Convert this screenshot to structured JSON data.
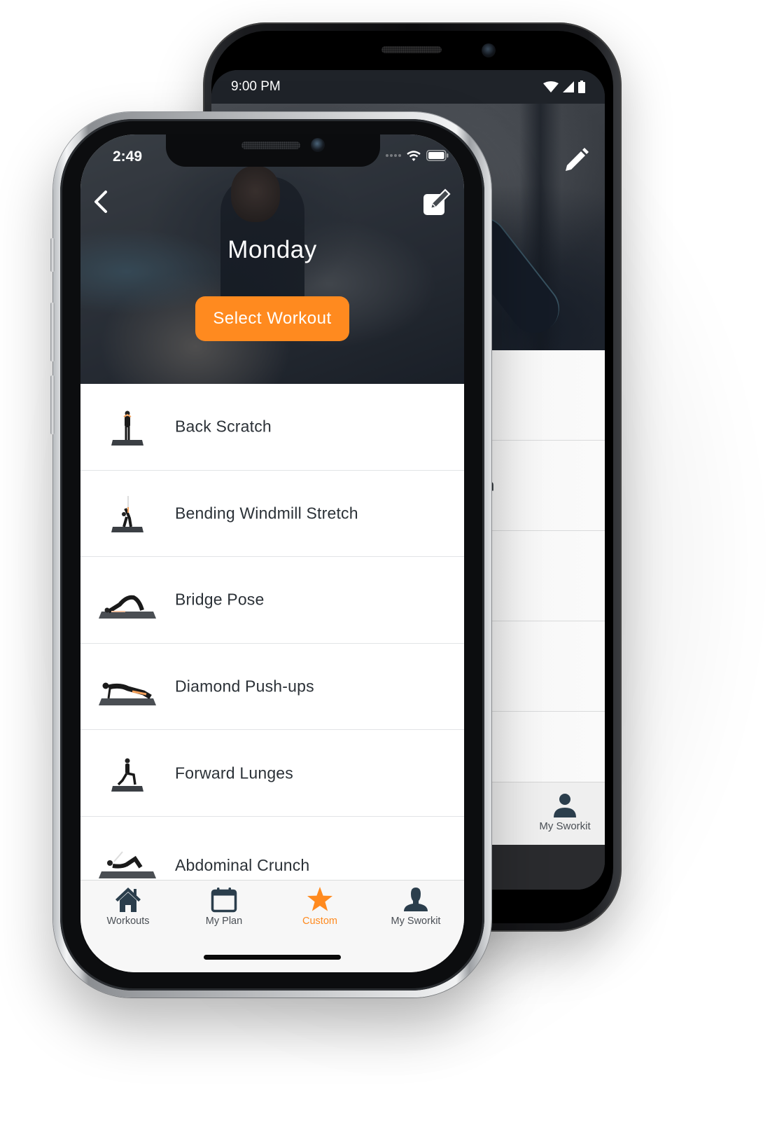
{
  "colors": {
    "accent": "#ff8a1f",
    "tab_icon": "#2b3e4c",
    "text_dark": "#2b3137"
  },
  "back_phone": {
    "status_time": "9:00 PM",
    "status_icons": [
      "wifi-icon",
      "signal-icon",
      "battery-icon"
    ],
    "edit_icon": "pencil-icon",
    "partial_list_text": "ch",
    "tab_label": "My Sworkit",
    "tab_icon": "person-icon"
  },
  "front_phone": {
    "status_time": "2:49",
    "status_icons": [
      "signal-dots-icon",
      "wifi-icon",
      "battery-icon"
    ],
    "header": {
      "back_icon": "chevron-left-icon",
      "edit_icon": "edit-square-icon",
      "title": "Monday",
      "select_button": "Select Workout"
    },
    "exercises": [
      {
        "name": "Back Scratch",
        "thumb": "standing-figure"
      },
      {
        "name": "Bending Windmill Stretch",
        "thumb": "bending-figure"
      },
      {
        "name": "Bridge Pose",
        "thumb": "bridge-figure"
      },
      {
        "name": "Diamond Push-ups",
        "thumb": "pushup-figure"
      },
      {
        "name": "Forward Lunges",
        "thumb": "lunge-figure"
      },
      {
        "name": "Abdominal Crunch",
        "thumb": "crunch-figure"
      }
    ],
    "tabs": [
      {
        "label": "Workouts",
        "icon": "home-icon",
        "active": false
      },
      {
        "label": "My Plan",
        "icon": "calendar-icon",
        "active": false
      },
      {
        "label": "Custom",
        "icon": "star-icon",
        "active": true
      },
      {
        "label": "My Sworkit",
        "icon": "person-icon",
        "active": false
      }
    ]
  }
}
